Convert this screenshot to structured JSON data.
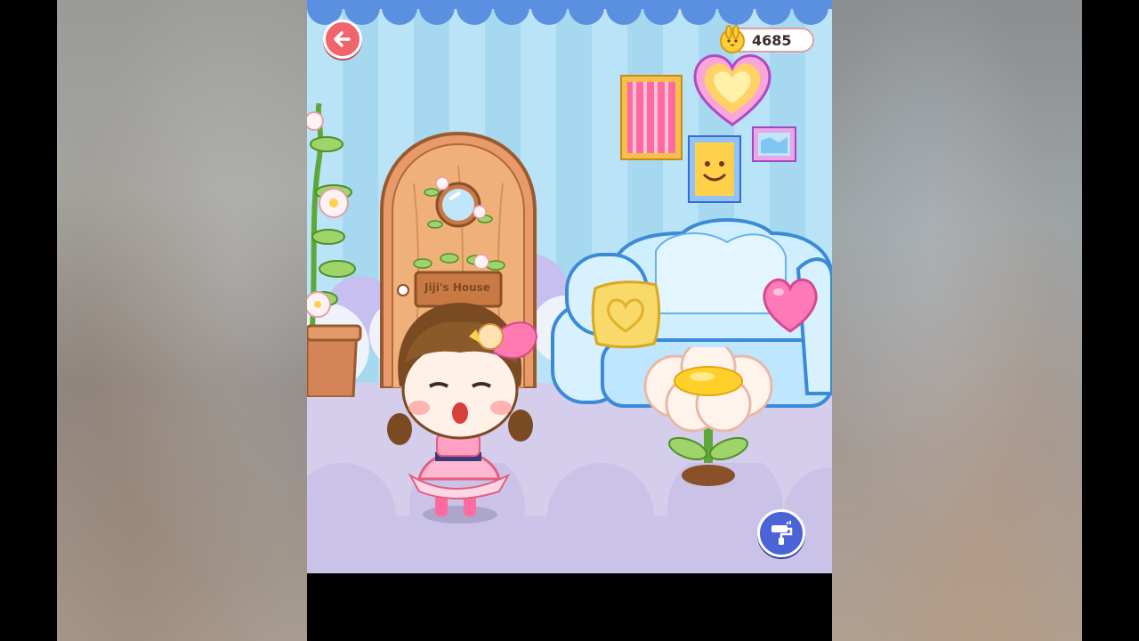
{
  "app": {
    "coins": "4685",
    "door_sign": "Jiji's House"
  },
  "icons": {
    "back": "back-arrow-icon",
    "coin": "bunny-coin-icon",
    "paint": "paint-roller-icon"
  },
  "colors": {
    "wall_light": "#b9e3f6",
    "wall_dark": "#a6d8f0",
    "scallop": "#5b8fe0",
    "floor": "#d5cdec",
    "back_button": "#f0646c",
    "paint_button": "#4a63d6"
  }
}
